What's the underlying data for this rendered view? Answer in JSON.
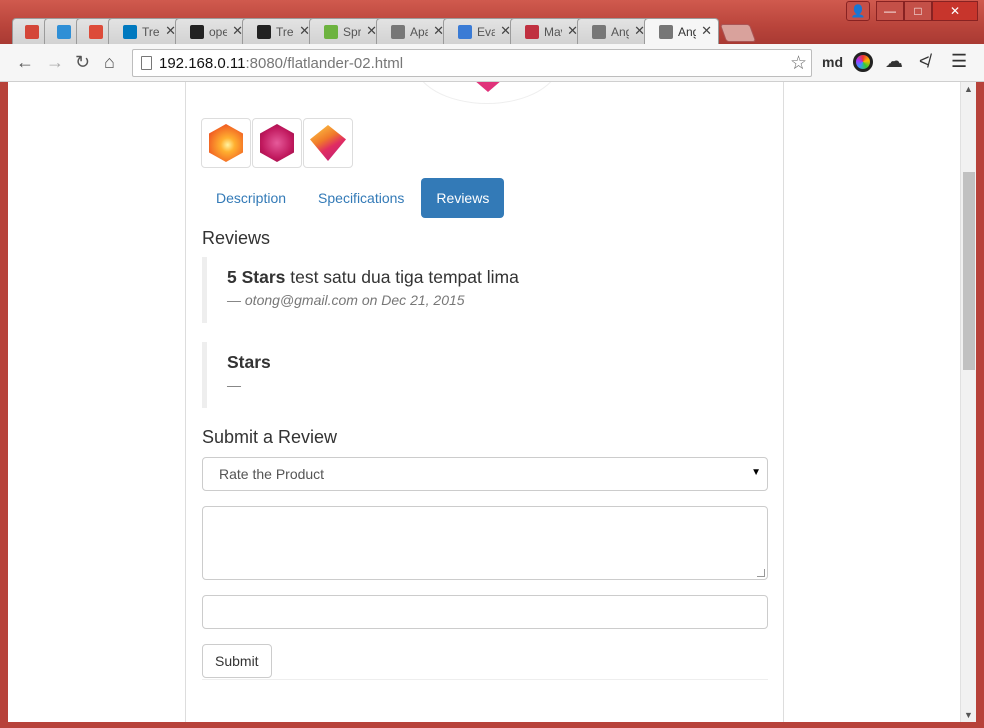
{
  "browser": {
    "tabs": [
      {
        "label": "",
        "icon": "gmail-icon",
        "color": "#d44638"
      },
      {
        "label": "",
        "icon": "drive-like-icon",
        "color": "#2f8fd6"
      },
      {
        "label": "",
        "icon": "google-plus-icon",
        "color": "#dd4b39"
      },
      {
        "label": "Trello",
        "icon": "trello-icon",
        "color": "#0079bf"
      },
      {
        "label": "open",
        "icon": "github-icon",
        "color": "#222222"
      },
      {
        "label": "Trend",
        "icon": "github-icon",
        "color": "#222222"
      },
      {
        "label": "Spring",
        "icon": "spring-icon",
        "color": "#6db33f"
      },
      {
        "label": "Apac",
        "icon": "page-icon",
        "color": "#777777"
      },
      {
        "label": "Evalu",
        "icon": "ring-icon",
        "color": "#3a7bd5"
      },
      {
        "label": "Mave",
        "icon": "feather-icon",
        "color": "#c03040"
      },
      {
        "label": "Ang",
        "icon": "page-icon",
        "color": "#777777"
      },
      {
        "label": "Ang",
        "icon": "page-icon",
        "color": "#777777",
        "active": true
      }
    ],
    "address": {
      "host": "192.168.0.11",
      "path": ":8080/flatlander-02.html"
    },
    "profile_label": "md"
  },
  "product": {
    "gallery": [
      {
        "name": "orange-gem"
      },
      {
        "name": "magenta-gem"
      },
      {
        "name": "diamond-gem"
      }
    ],
    "tabs": [
      "Description",
      "Specifications",
      "Reviews"
    ],
    "active_tab": "Reviews"
  },
  "reviews": {
    "heading": "Reviews",
    "items": [
      {
        "stars": "5 Stars",
        "body": " test satu dua tiga tempat lima",
        "meta": "— otong@gmail.com on Dec 21, 2015"
      },
      {
        "stars": "Stars",
        "body": "",
        "meta": "—"
      }
    ]
  },
  "form": {
    "heading": "Submit a Review",
    "rating_placeholder": "Rate the Product",
    "body_value": "",
    "author_value": "",
    "submit_label": "Submit"
  }
}
